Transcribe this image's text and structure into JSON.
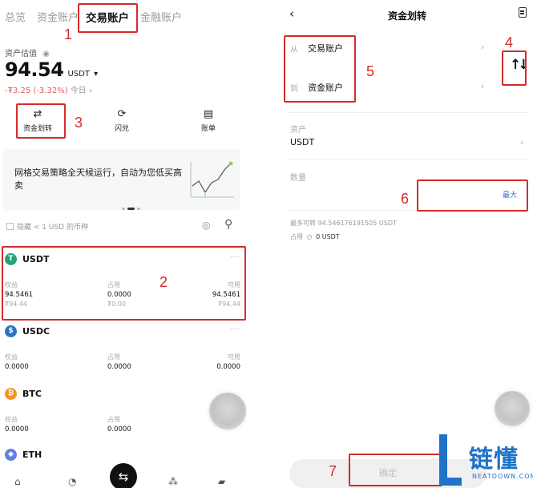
{
  "left": {
    "tabs": [
      "总览",
      "资金账户",
      "交易账户",
      "金融账户"
    ],
    "asset_label": "资产估值",
    "total_value": "94.54",
    "unit": "USDT",
    "change": "-₮3.25 (-3.32%)",
    "today": "今日",
    "quick_actions": [
      "资金划转",
      "闪兑",
      "账单"
    ],
    "banner_text": "网格交易策略全天候运行，自动为您低买高卖",
    "filter_text": "隐藏 < 1 USD 的币种",
    "column_labels": [
      "权益",
      "占用",
      "可用"
    ],
    "coins": [
      {
        "name": "USDT",
        "logo_letter": "T",
        "color": "#26a17b",
        "equity": "94.5461",
        "equity_sub": "₮94.44",
        "occupied": "0.0000",
        "occupied_sub": "₮0.00",
        "available": "94.5461",
        "available_sub": "₮94.44"
      },
      {
        "name": "USDC",
        "logo_letter": "$",
        "color": "#2775ca",
        "equity": "0.0000",
        "occupied": "0.0000",
        "available": "0.0000"
      },
      {
        "name": "BTC",
        "logo_letter": "₿",
        "color": "#f7931a",
        "equity": "0.0000",
        "occupied": "0.0000",
        "available": "0.0000"
      },
      {
        "name": "ETH",
        "logo_letter": "◆",
        "color": "#627eea"
      }
    ]
  },
  "right": {
    "title": "资金划转",
    "from_label": "从",
    "from_account": "交易账户",
    "to_label": "到",
    "to_account": "资金账户",
    "asset_label": "资产",
    "asset_value": "USDT",
    "amount_label": "数量",
    "max_label": "最大",
    "max_transferable": "最多可转 94.546176191505 USDT",
    "occupied_label": "占用",
    "occupied_value": "0 USDT",
    "confirm": "确定"
  },
  "annotations": [
    "1",
    "2",
    "3",
    "4",
    "5",
    "6",
    "7"
  ],
  "watermark": {
    "text": "链懂",
    "sub": "NEATDOWN.COM"
  },
  "colors": {
    "annotation": "#d42b2b",
    "negative": "#e25a5a",
    "watermark": "#1e73c8"
  }
}
